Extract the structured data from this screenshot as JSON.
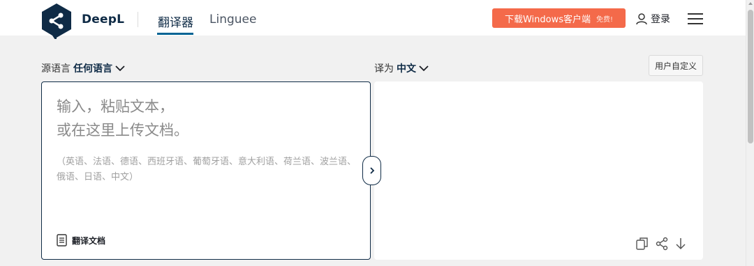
{
  "header": {
    "brand": "DeepL",
    "tabs": [
      {
        "label": "翻译器",
        "active": true
      },
      {
        "label": "Linguee",
        "active": false
      }
    ],
    "download_label": "下载Windows客户端",
    "download_badge": "免费!",
    "login_label": "登录"
  },
  "language_bar": {
    "source_prefix": "源语言",
    "source_value": "任何语言",
    "target_prefix": "译为",
    "target_value": "中文",
    "customize_label": "用户自定义"
  },
  "source_panel": {
    "placeholder_line1": "输入，粘贴文本，",
    "placeholder_line2": "或在这里上传文档。",
    "supported_languages": "（英语、法语、德语、西班牙语、葡萄牙语、意大利语、荷兰语、波兰语、俄语、日语、中文）",
    "translate_document_label": "翻译文档"
  },
  "colors": {
    "brand_navy": "#0f2b46",
    "download_orange": "#f46a4a",
    "active_tab_underline": "#006494"
  },
  "icons": [
    "deepl-logo-icon",
    "user-icon",
    "menu-icon",
    "chevron-down-icon",
    "document-icon",
    "chevron-right-icon",
    "copy-icon",
    "share-icon",
    "download-arrow-icon"
  ]
}
